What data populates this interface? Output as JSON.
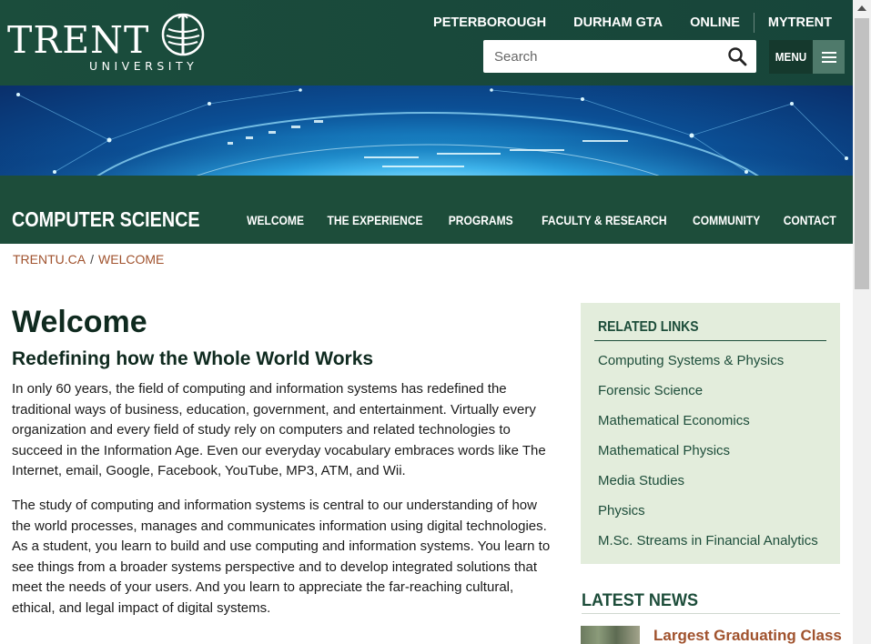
{
  "brand": {
    "logo_word": "TRENT",
    "logo_sub": "UNIVERSITY",
    "colors": {
      "dark_green": "#1d4d3a",
      "link_rust": "#a0522d",
      "sidebar_bg": "#e3eddc"
    }
  },
  "campus_nav": [
    "PETERBOROUGH",
    "DURHAM GTA",
    "ONLINE",
    "MYTRENT"
  ],
  "search": {
    "placeholder": "Search",
    "icon": "search-icon"
  },
  "menu": {
    "label": "MENU",
    "icon": "hamburger-icon"
  },
  "department": {
    "title": "COMPUTER SCIENCE",
    "nav": [
      "WELCOME",
      "THE EXPERIENCE",
      "PROGRAMS",
      "FACULTY & RESEARCH",
      "COMMUNITY",
      "CONTACT"
    ]
  },
  "breadcrumb": {
    "home": "TRENTU.CA",
    "separator": "/",
    "current": "WELCOME"
  },
  "main": {
    "title": "Welcome",
    "subtitle": "Redefining how the Whole World Works",
    "paragraphs": [
      "In only 60 years, the field of computing and information systems has redefined the traditional ways of business, education, government, and entertainment.  Virtually every organization and every field of study rely on computers and related technologies to succeed in the Information Age.  Even our everyday vocabulary embraces words like The Internet, email, Google, Facebook, YouTube, MP3, ATM, and Wii.",
      "The study of computing and information systems is central to our understanding of how the world processes, manages and communicates information using digital technologies.  As a student, you learn to build and use computing and information systems.  You learn to see things from a broader systems perspective and to develop integrated solutions that meet the needs of your users.  And you learn to appreciate the far-reaching cultural, ethical, and legal impact of digital systems."
    ]
  },
  "related_links": {
    "heading": "RELATED LINKS",
    "items": [
      "Computing Systems & Physics",
      "Forensic Science",
      "Mathematical Economics",
      "Mathematical Physics",
      "Media Studies",
      "Physics",
      "M.Sc. Streams in Financial Analytics"
    ]
  },
  "latest_news": {
    "heading": "LATEST NEWS",
    "items": [
      {
        "title": "Largest Graduating Class"
      }
    ]
  }
}
